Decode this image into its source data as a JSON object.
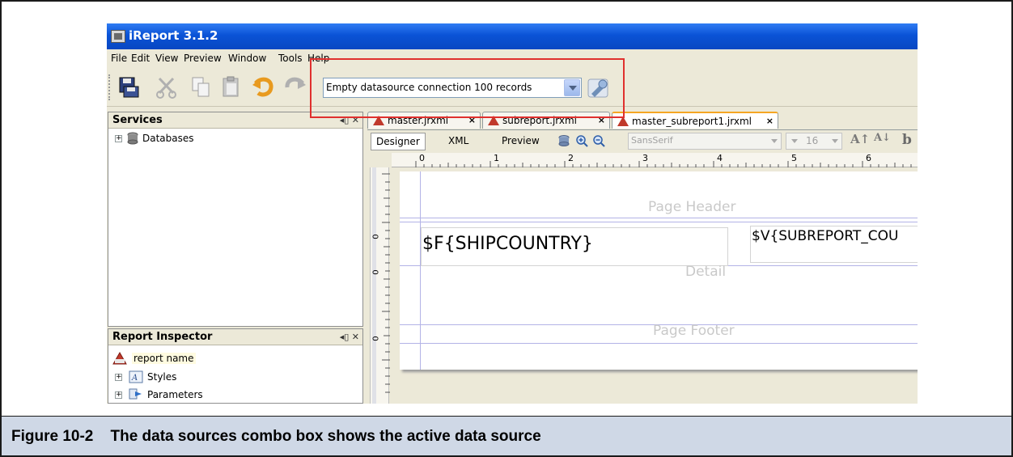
{
  "window": {
    "title": "iReport 3.1.2"
  },
  "menu": [
    {
      "label": "File"
    },
    {
      "label": "Edit"
    },
    {
      "label": "View"
    },
    {
      "label": "Preview"
    },
    {
      "label": "Window"
    },
    {
      "label": "Tools"
    },
    {
      "label": "Help"
    }
  ],
  "toolbar": {
    "icons": [
      "save-icon",
      "cut-icon",
      "copy-icon",
      "paste-icon",
      "undo-icon",
      "redo-icon"
    ],
    "datasource_combo": {
      "selected": "Empty datasource connection 100 records"
    },
    "datasource_button_icon": "datasource-wizard-icon"
  },
  "services": {
    "title": "Services",
    "controls": "◂▯ ✕",
    "items": [
      {
        "label": "Databases",
        "icon": "database-icon"
      }
    ]
  },
  "inspector": {
    "title": "Report Inspector",
    "controls": "◂▯ ✕",
    "items": [
      {
        "label": "report name",
        "icon": "report-icon"
      },
      {
        "label": "Styles",
        "icon": "styles-icon"
      },
      {
        "label": "Parameters",
        "icon": "parameters-icon"
      }
    ]
  },
  "tabs": [
    {
      "label": "master.jrxml",
      "active": false
    },
    {
      "label": "subreport.jrxml",
      "active": false
    },
    {
      "label": "master_subreport1.jrxml",
      "active": true
    }
  ],
  "tab_close": "×",
  "editor_toolbar": {
    "views": [
      "Designer",
      "XML",
      "Preview"
    ],
    "active_view": "Designer",
    "font": "SansSerif",
    "size": "16",
    "bold_glyph": "b"
  },
  "ruler": {
    "h": [
      "0",
      "1",
      "2",
      "3",
      "4",
      "5",
      "6"
    ],
    "v": [
      "0",
      "0",
      "0"
    ]
  },
  "report": {
    "page_header": "Page Header",
    "detail": "Detail",
    "page_footer": "Page Footer",
    "field_shipcountry": "$F{SHIPCOUNTRY}",
    "field_subreport": "$V{SUBREPORT_COU"
  },
  "caption": {
    "number": "Figure 10-2",
    "text": "The data sources combo box shows the active data source"
  },
  "colors": {
    "highlight": "#e0302e",
    "titlebar": "#0a53d6",
    "caption_bg": "#cfd8e6"
  }
}
